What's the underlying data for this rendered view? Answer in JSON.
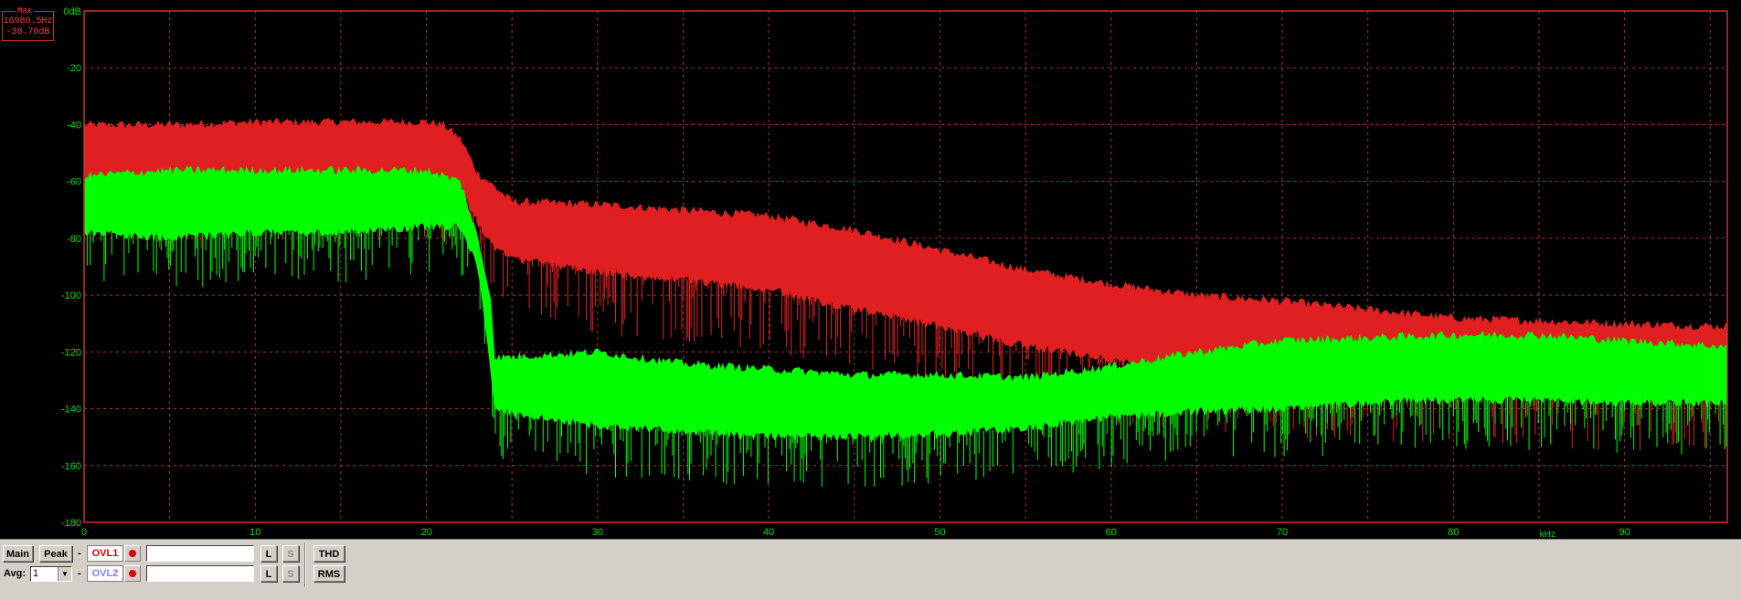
{
  "marker": {
    "title": "Max",
    "freq": "16980.5Hz",
    "level": "-38.70dB"
  },
  "y_axis": {
    "ticks": [
      "0dB",
      "-20",
      "-40",
      "-60",
      "-80",
      "-100",
      "-120",
      "-140",
      "-160",
      "-180"
    ]
  },
  "x_axis": {
    "ticks": [
      "0",
      "10",
      "20",
      "30",
      "40",
      "50",
      "60",
      "70",
      "80",
      "90"
    ],
    "unit": "kHz"
  },
  "colors": {
    "channel1": "#e02020",
    "channel2": "#00ff00",
    "grid": "#b03030",
    "frame": "#c83232"
  },
  "toolbar": {
    "main_label": "Main",
    "peak_label": "Peak",
    "avg_label": "Avg:",
    "avg_value": "1",
    "dash1": "-",
    "dash2": "-",
    "ovl1_label": "OVL1",
    "ovl2_label": "OVL2",
    "l_label": "L",
    "s_label": "S",
    "thd_label": "THD",
    "rms_label": "RMS"
  },
  "chart_data": {
    "type": "line",
    "title": "",
    "xlabel": "kHz",
    "ylabel": "dB",
    "xlim": [
      0,
      96
    ],
    "ylim": [
      -180,
      0
    ],
    "grid": true,
    "series": [
      {
        "color": "#e02020",
        "upper": [
          [
            0,
            -40
          ],
          [
            5,
            -40
          ],
          [
            10,
            -39
          ],
          [
            15,
            -39
          ],
          [
            20,
            -39
          ],
          [
            21,
            -40
          ],
          [
            22,
            -45
          ],
          [
            23,
            -57
          ],
          [
            25,
            -67
          ],
          [
            30,
            -68
          ],
          [
            35,
            -70
          ],
          [
            40,
            -72
          ],
          [
            45,
            -77
          ],
          [
            50,
            -84
          ],
          [
            55,
            -91
          ],
          [
            60,
            -96
          ],
          [
            65,
            -100
          ],
          [
            70,
            -102
          ],
          [
            75,
            -105
          ],
          [
            80,
            -108
          ],
          [
            85,
            -109
          ],
          [
            90,
            -110
          ],
          [
            96,
            -111
          ]
        ],
        "lower": [
          [
            0,
            -60
          ],
          [
            5,
            -62
          ],
          [
            10,
            -62
          ],
          [
            15,
            -62
          ],
          [
            20,
            -60
          ],
          [
            22,
            -62
          ],
          [
            23,
            -75
          ],
          [
            24,
            -84
          ],
          [
            25,
            -87
          ],
          [
            30,
            -92
          ],
          [
            35,
            -95
          ],
          [
            40,
            -98
          ],
          [
            45,
            -105
          ],
          [
            50,
            -111
          ],
          [
            55,
            -118
          ],
          [
            60,
            -123
          ],
          [
            65,
            -126
          ],
          [
            70,
            -128
          ],
          [
            75,
            -130
          ],
          [
            80,
            -131
          ],
          [
            85,
            -132
          ],
          [
            90,
            -133
          ],
          [
            96,
            -133
          ]
        ]
      },
      {
        "color": "#00ff00",
        "upper": [
          [
            0,
            -58
          ],
          [
            5,
            -56
          ],
          [
            10,
            -56
          ],
          [
            15,
            -56
          ],
          [
            20,
            -56
          ],
          [
            22,
            -60
          ],
          [
            23,
            -80
          ],
          [
            23.8,
            -102
          ],
          [
            24,
            -122
          ],
          [
            30,
            -120
          ],
          [
            35,
            -124
          ],
          [
            40,
            -126
          ],
          [
            45,
            -128
          ],
          [
            50,
            -128
          ],
          [
            55,
            -129
          ],
          [
            60,
            -125
          ],
          [
            65,
            -120
          ],
          [
            70,
            -116
          ],
          [
            75,
            -115
          ],
          [
            80,
            -114
          ],
          [
            85,
            -114
          ],
          [
            90,
            -116
          ],
          [
            96,
            -118
          ]
        ],
        "lower": [
          [
            0,
            -78
          ],
          [
            5,
            -80
          ],
          [
            10,
            -78
          ],
          [
            15,
            -78
          ],
          [
            20,
            -76
          ],
          [
            22,
            -76
          ],
          [
            23,
            -90
          ],
          [
            24,
            -140
          ],
          [
            25,
            -142
          ],
          [
            30,
            -146
          ],
          [
            35,
            -148
          ],
          [
            40,
            -150
          ],
          [
            45,
            -150
          ],
          [
            50,
            -149
          ],
          [
            55,
            -147
          ],
          [
            60,
            -143
          ],
          [
            65,
            -141
          ],
          [
            70,
            -140
          ],
          [
            75,
            -138
          ],
          [
            80,
            -137
          ],
          [
            85,
            -137
          ],
          [
            90,
            -138
          ],
          [
            96,
            -138
          ]
        ]
      }
    ]
  }
}
